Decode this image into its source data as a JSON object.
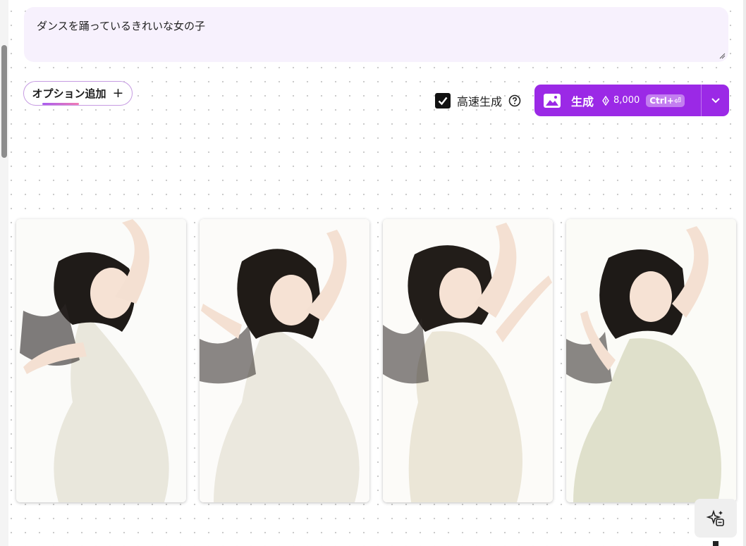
{
  "prompt": {
    "text": "ダンスを踊っているきれいな女の子"
  },
  "options": {
    "add_label": "オプション追加",
    "add_icon": "+"
  },
  "fast_mode": {
    "label": "高速生成",
    "checked": true,
    "help_icon": "help-circle-icon"
  },
  "generate": {
    "label": "生成",
    "credits": "8,000",
    "shortcut": "Ctrl+⏎",
    "icon": "image-icon",
    "dropdown_icon": "chevron-down-icon"
  },
  "gallery": {
    "images": [
      {
        "alt": "dancing-girl-1"
      },
      {
        "alt": "dancing-girl-2"
      },
      {
        "alt": "dancing-girl-3"
      },
      {
        "alt": "dancing-girl-4"
      }
    ]
  },
  "fab": {
    "icon": "ai-edit-icon"
  },
  "colors": {
    "accent": "#9b29e6",
    "prompt_bg": "#f7f1fd",
    "option_border": "#c69be2"
  }
}
